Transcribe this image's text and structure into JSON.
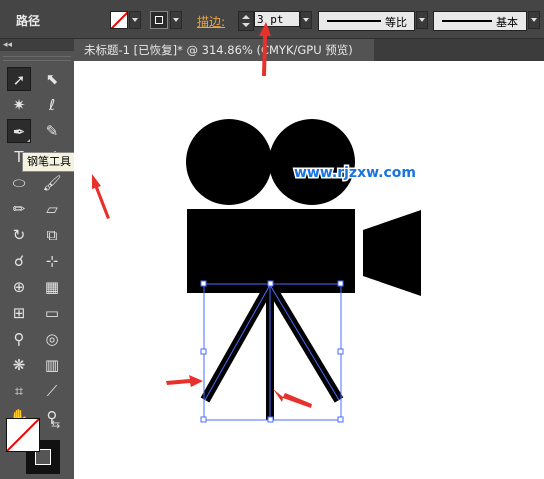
{
  "control_bar": {
    "tool_title": "路径",
    "stroke_label": "描边:",
    "stroke_weight": "3 pt",
    "profile1": "等比",
    "profile2": "基本"
  },
  "toolbox": {
    "tooltip": "钢笔工具 (P)",
    "tools": [
      "selection-icon",
      "direct-selection-icon",
      "magic-wand-icon",
      "lasso-icon",
      "pen-icon",
      "curvature-icon",
      "type-icon",
      "line-icon",
      "ellipse-icon",
      "paintbrush-icon",
      "pencil-icon",
      "eraser-icon",
      "rotate-icon",
      "scale-icon",
      "warp-icon",
      "free-transform-icon",
      "shape-builder-icon",
      "perspective-grid-icon",
      "mesh-icon",
      "gradient-icon",
      "eyedropper-icon",
      "blend-icon",
      "symbol-sprayer-icon",
      "column-graph-icon",
      "artboard-icon",
      "slice-icon",
      "hand-icon",
      "zoom-icon"
    ]
  },
  "document": {
    "tab_title": "未标题-1 [已恢复]* @ 314.86% (CMYK/GPU 预览)",
    "close": "×"
  },
  "watermark": "www.rjzxw.com",
  "colors": {
    "selection": "#4a6cff",
    "annotation": "#e8312a",
    "watermark": "#1a75e0"
  }
}
